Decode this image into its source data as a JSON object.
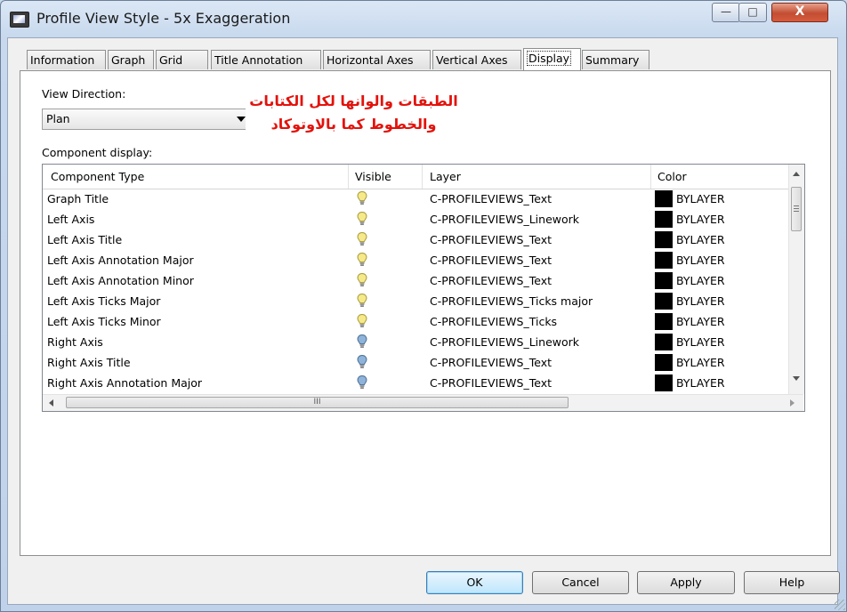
{
  "window": {
    "title": "Profile View Style - 5x Exaggeration",
    "minimize_glyph": "—",
    "maximize_glyph": "□",
    "close_glyph": "X"
  },
  "tabs": [
    {
      "label": "Information",
      "active": false
    },
    {
      "label": "Graph",
      "active": false
    },
    {
      "label": "Grid",
      "active": false
    },
    {
      "label": "Title Annotation",
      "active": false
    },
    {
      "label": "Horizontal Axes",
      "active": false
    },
    {
      "label": "Vertical Axes",
      "active": false
    },
    {
      "label": "Display",
      "active": true
    },
    {
      "label": "Summary",
      "active": false
    }
  ],
  "view_direction": {
    "label": "View Direction:",
    "value": "Plan"
  },
  "annotation": {
    "line1": "الطبقات والوانها لكل الكتابات",
    "line2": "والخطوط كما بالاوتوكاد"
  },
  "component_display": {
    "label": "Component display:",
    "columns": [
      "Component Type",
      "Visible",
      "Layer",
      "Color"
    ],
    "rows": [
      {
        "type": "Graph Title",
        "visible_icon": "lightbulb-on-icon",
        "layer": "C-PROFILEVIEWS_Text",
        "color": "BYLAYER"
      },
      {
        "type": "Left Axis",
        "visible_icon": "lightbulb-on-icon",
        "layer": "C-PROFILEVIEWS_Linework",
        "color": "BYLAYER"
      },
      {
        "type": "Left Axis Title",
        "visible_icon": "lightbulb-on-icon",
        "layer": "C-PROFILEVIEWS_Text",
        "color": "BYLAYER"
      },
      {
        "type": "Left Axis Annotation Major",
        "visible_icon": "lightbulb-on-icon",
        "layer": "C-PROFILEVIEWS_Text",
        "color": "BYLAYER"
      },
      {
        "type": "Left Axis Annotation Minor",
        "visible_icon": "lightbulb-on-icon",
        "layer": "C-PROFILEVIEWS_Text",
        "color": "BYLAYER"
      },
      {
        "type": "Left Axis Ticks Major",
        "visible_icon": "lightbulb-on-icon",
        "layer": "C-PROFILEVIEWS_Ticks major",
        "color": "BYLAYER"
      },
      {
        "type": "Left Axis Ticks Minor",
        "visible_icon": "lightbulb-on-icon",
        "layer": "C-PROFILEVIEWS_Ticks",
        "color": "BYLAYER"
      },
      {
        "type": "Right Axis",
        "visible_icon": "lightbulb-off-icon",
        "layer": "C-PROFILEVIEWS_Linework",
        "color": "BYLAYER"
      },
      {
        "type": "Right Axis Title",
        "visible_icon": "lightbulb-off-icon",
        "layer": "C-PROFILEVIEWS_Text",
        "color": "BYLAYER"
      },
      {
        "type": "Right Axis Annotation Major",
        "visible_icon": "lightbulb-off-icon",
        "layer": "C-PROFILEVIEWS_Text",
        "color": "BYLAYER"
      }
    ],
    "hscroll_grip": "III"
  },
  "buttons": {
    "ok": "OK",
    "cancel": "Cancel",
    "apply": "Apply",
    "help": "Help"
  },
  "colors": {
    "bulb_on": "#f5e98a",
    "bulb_off": "#8fb3d9",
    "annotation_text": "#e3120b",
    "swatch": "#000000"
  }
}
